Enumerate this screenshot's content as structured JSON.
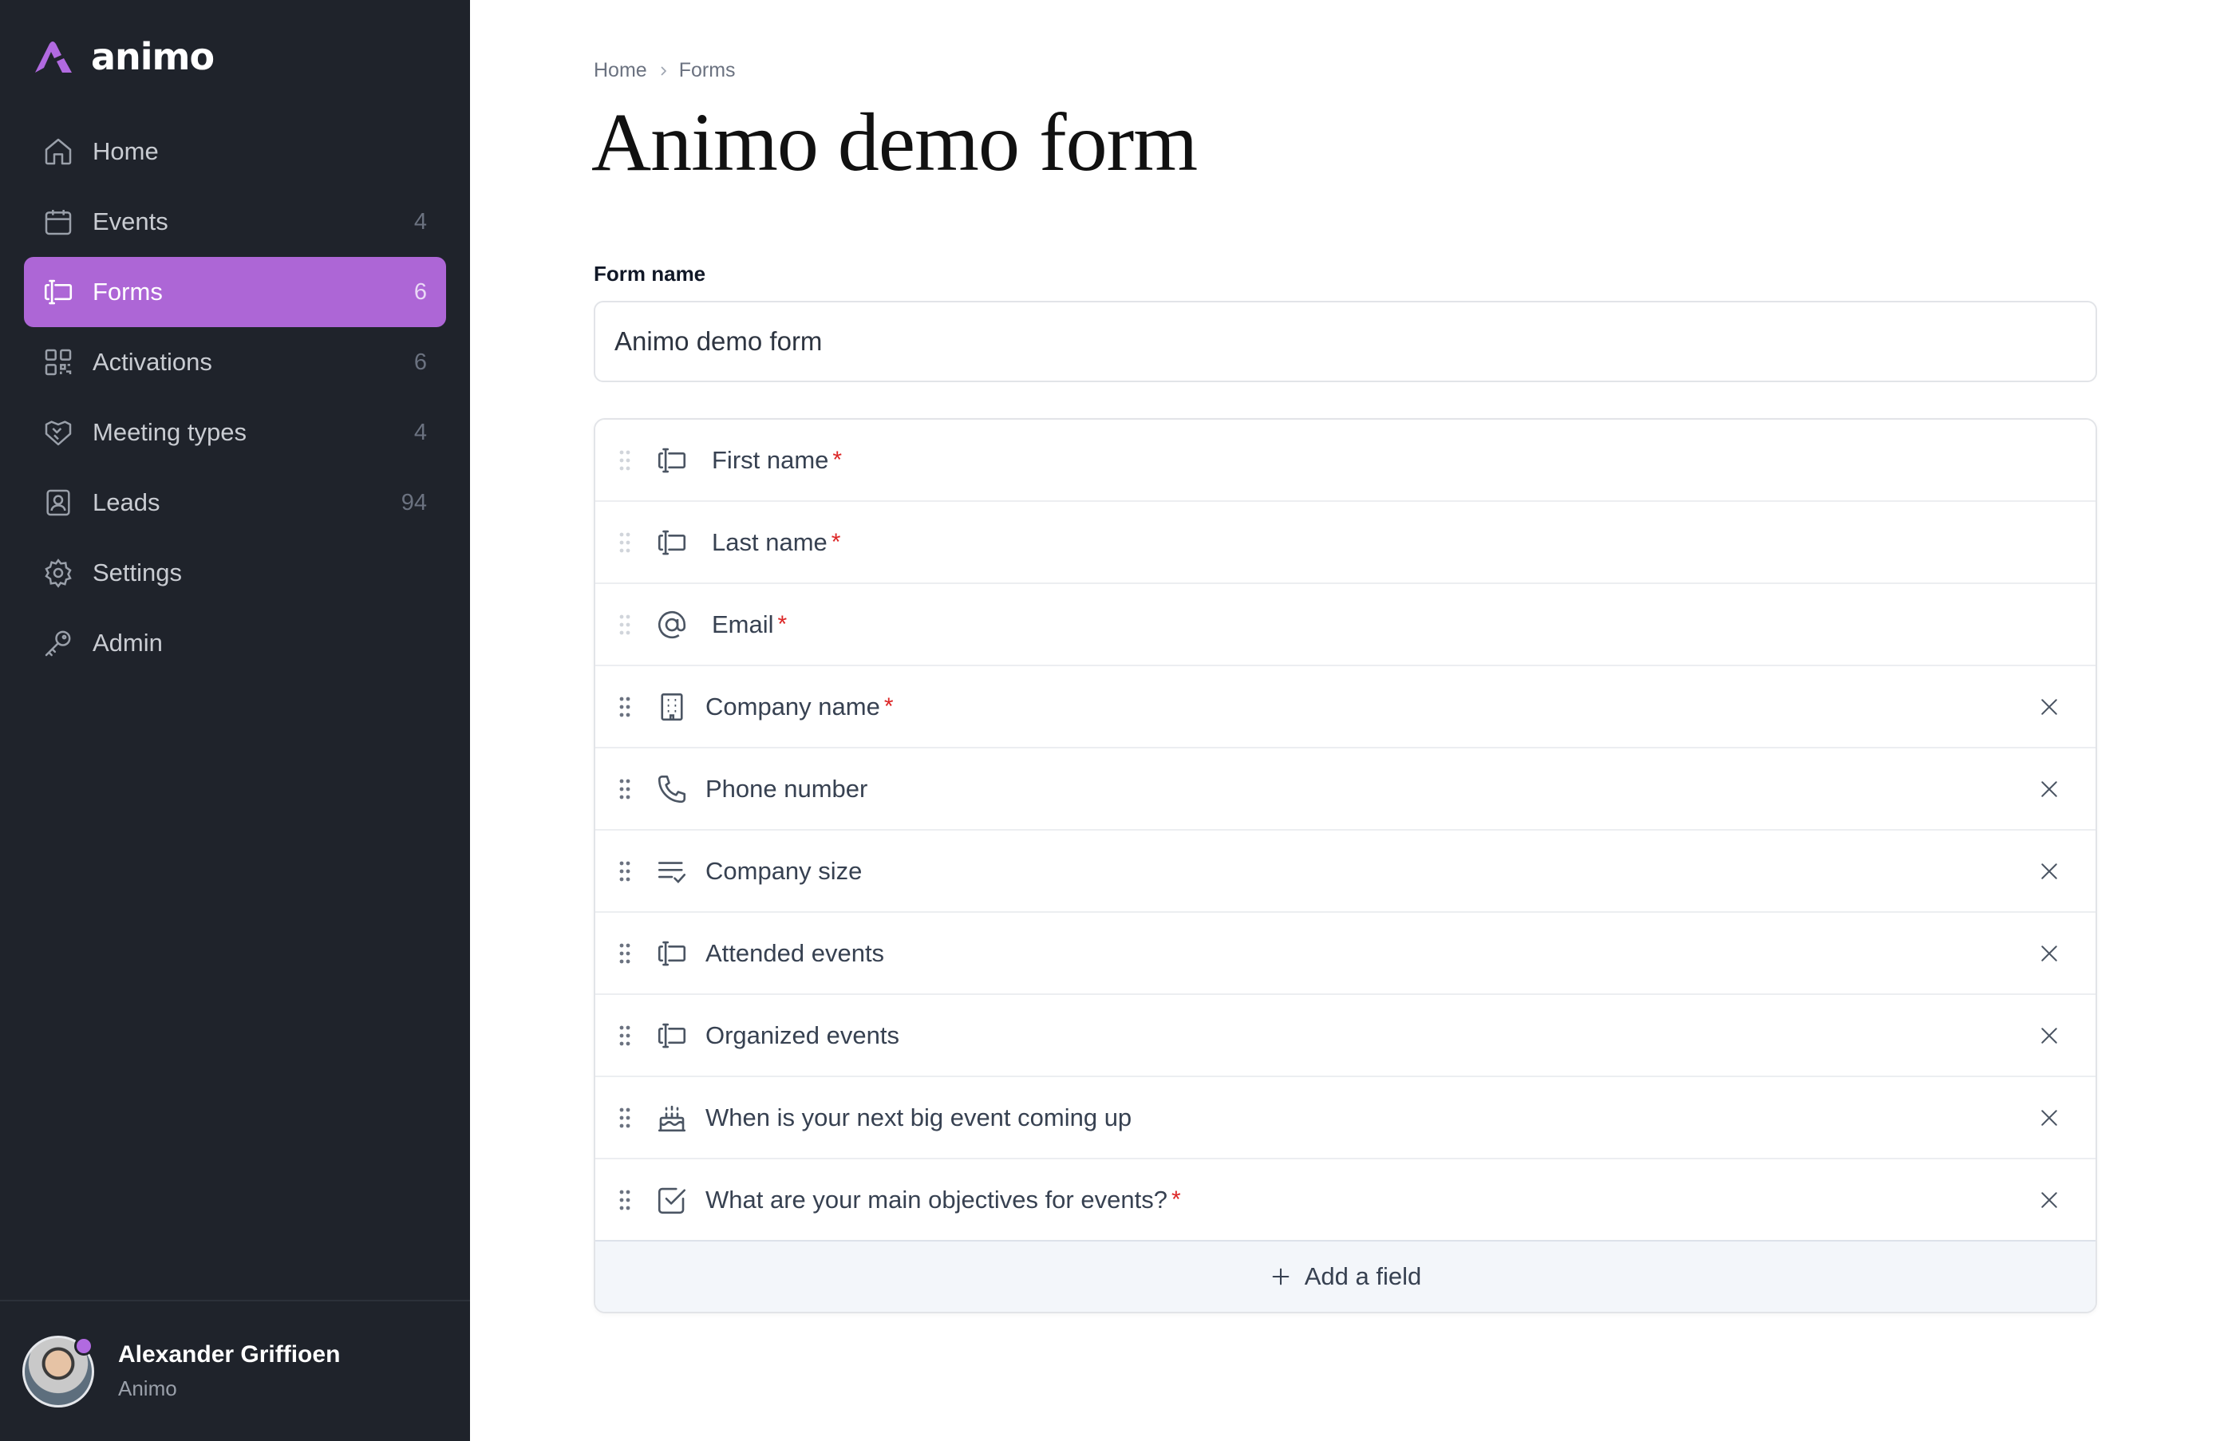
{
  "brand": {
    "name": "animo",
    "accent": "#ad66d6"
  },
  "sidebar": {
    "items": [
      {
        "label": "Home",
        "count": "",
        "icon": "home-icon"
      },
      {
        "label": "Events",
        "count": "4",
        "icon": "calendar-icon"
      },
      {
        "label": "Forms",
        "count": "6",
        "icon": "form-field-icon",
        "active": true
      },
      {
        "label": "Activations",
        "count": "6",
        "icon": "qr-code-icon"
      },
      {
        "label": "Meeting types",
        "count": "4",
        "icon": "handshake-icon"
      },
      {
        "label": "Leads",
        "count": "94",
        "icon": "contact-card-icon"
      },
      {
        "label": "Settings",
        "count": "",
        "icon": "gear-icon"
      },
      {
        "label": "Admin",
        "count": "",
        "icon": "key-icon"
      }
    ],
    "user": {
      "name": "Alexander Griffioen",
      "org": "Animo"
    }
  },
  "breadcrumb": {
    "home": "Home",
    "current": "Forms"
  },
  "page": {
    "title": "Animo demo form"
  },
  "form": {
    "name_label": "Form name",
    "name_value": "Animo demo form",
    "fields": [
      {
        "label": "First name",
        "required": "*",
        "icon": "text-field-icon"
      },
      {
        "label": "Last name",
        "required": "*",
        "icon": "text-field-icon"
      },
      {
        "label": "Email",
        "required": "*",
        "icon": "at-sign-icon"
      },
      {
        "label": "Company name",
        "required": "*",
        "icon": "building-icon"
      },
      {
        "label": "Phone number",
        "required": "",
        "icon": "phone-icon"
      },
      {
        "label": "Company size",
        "required": "",
        "icon": "list-check-icon"
      },
      {
        "label": "Attended events",
        "required": "",
        "icon": "text-field-icon"
      },
      {
        "label": "Organized events",
        "required": "",
        "icon": "text-field-icon"
      },
      {
        "label": "When is your next big event coming up",
        "required": "",
        "icon": "cake-icon"
      },
      {
        "label": "What are your main objectives for events?",
        "required": "*",
        "icon": "checkbox-icon"
      }
    ],
    "add_field_label": "Add a field"
  }
}
